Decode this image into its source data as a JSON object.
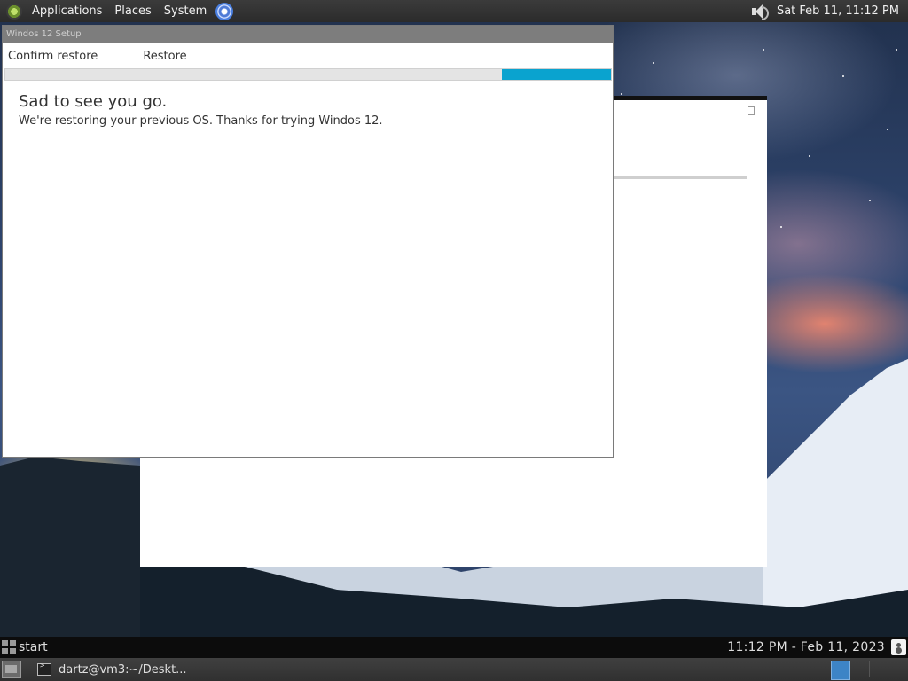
{
  "top_panel": {
    "menus": [
      "Applications",
      "Places",
      "System"
    ],
    "clock": "Sat Feb 11, 11:12 PM"
  },
  "setup_window": {
    "title": "Windos 12 Setup",
    "steps": [
      "Confirm restore",
      "Restore"
    ],
    "progress_fraction": 0.18,
    "headline": "Sad to see you go.",
    "message": "We're restoring your previous OS. Thanks for trying Windos 12."
  },
  "start_bar": {
    "start_label": "start",
    "clock": "11:12 PM - Feb 11, 2023"
  },
  "window_bar": {
    "task_label": "dartz@vm3:~/Deskt..."
  },
  "colors": {
    "progress": "#0aa3cf",
    "panel": "#2b2b2b",
    "title_bar": "#7d7d7d"
  },
  "icons": [
    "distro-logo-icon",
    "chrome-icon",
    "speaker-icon",
    "start-icon",
    "user-icon",
    "show-desktop-icon",
    "terminal-icon",
    "workspace-icon"
  ]
}
